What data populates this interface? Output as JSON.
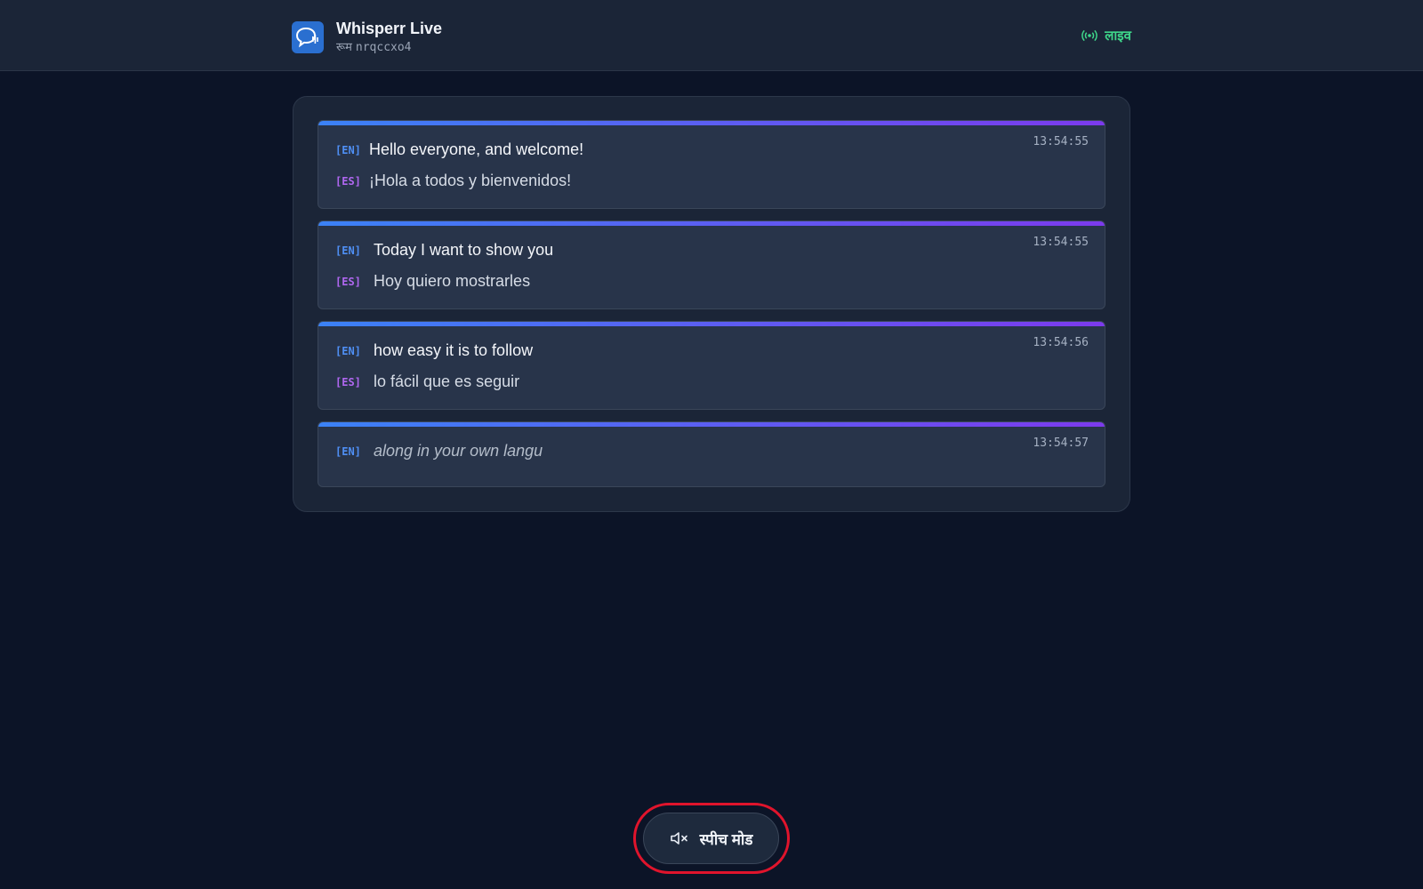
{
  "header": {
    "title": "Whisperr Live",
    "room_label": "रूम",
    "room_id": "nrqccxo4",
    "status": "लाइव",
    "status_color": "#3ed68a"
  },
  "messages": [
    {
      "time": "13:54:55",
      "en_tag": "[EN]",
      "en": "Hello everyone, and welcome!",
      "es_tag": "[ES]",
      "es": "¡Hola a todos y bienvenidos!"
    },
    {
      "time": "13:54:55",
      "en_tag": "[EN]",
      "en": "Today I want to show you",
      "es_tag": "[ES]",
      "es": "Hoy quiero mostrarles"
    },
    {
      "time": "13:54:56",
      "en_tag": "[EN]",
      "en": "how easy it is to follow",
      "es_tag": "[ES]",
      "es": "lo fácil que es seguir"
    },
    {
      "time": "13:54:57",
      "en_tag": "[EN]",
      "en": "along in your own langu"
    }
  ],
  "footer": {
    "speech_mode_label": "स्पीच मोड",
    "speech_icon": "speaker-muted-icon"
  },
  "colors": {
    "accent_start": "#3b82f6",
    "accent_end": "#7c3aed",
    "en_tag": "#4f8ff5",
    "es_tag": "#b067f0",
    "highlight_ring": "#e0142c"
  }
}
